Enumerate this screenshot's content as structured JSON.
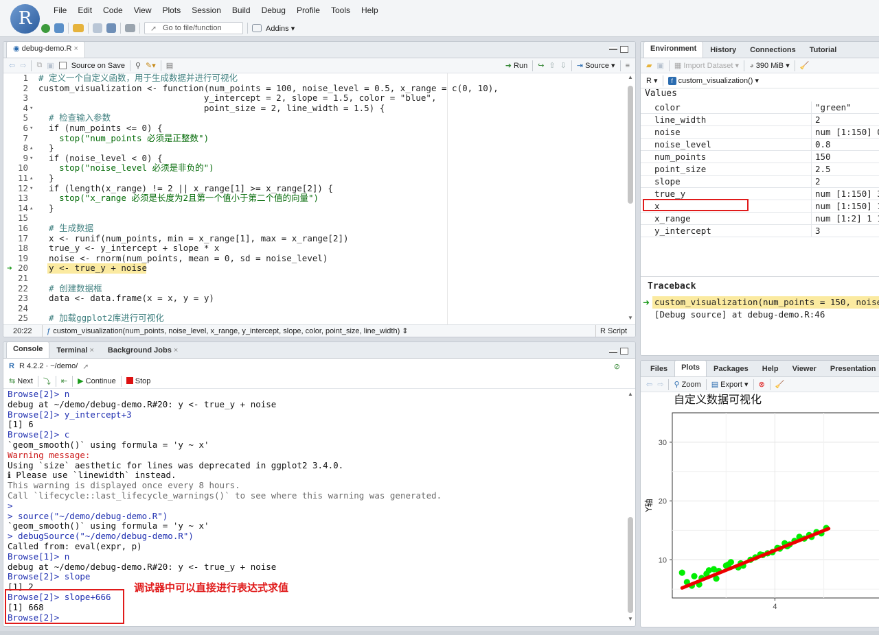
{
  "menubar": {
    "logo": "R",
    "menus": [
      "File",
      "Edit",
      "Code",
      "View",
      "Plots",
      "Session",
      "Build",
      "Debug",
      "Profile",
      "Tools",
      "Help"
    ],
    "goto_placeholder": "Go to file/function",
    "addins": "Addins"
  },
  "editor": {
    "tab_label": "debug-demo.R",
    "source_on_save": "Source on Save",
    "run_label": "Run",
    "source_label": "Source",
    "cursor_pos": "20:22",
    "function_crumb": "custom_visualization(num_points, noise_level, x_range, y_intercept, slope, color, point_size, line_width)",
    "file_type": "R Script",
    "lines": [
      {
        "n": "1",
        "fold": "",
        "text": "# 定义一个自定义函数，用于生成数据并进行可视化",
        "cls": "cm"
      },
      {
        "n": "2",
        "fold": "",
        "text": "custom_visualization <- function(num_points = 100, noise_level = 0.5, x_range = c(0, 10),",
        "cls": "fn"
      },
      {
        "n": "3",
        "fold": "",
        "text": "                                y_intercept = 2, slope = 1.5, color = \"blue\",",
        "cls": "fn"
      },
      {
        "n": "4",
        "fold": "▾",
        "text": "                                point_size = 2, line_width = 1.5) {",
        "cls": "fn"
      },
      {
        "n": "5",
        "fold": "",
        "text": "  # 检查输入参数",
        "cls": "cm"
      },
      {
        "n": "6",
        "fold": "▾",
        "text": "  if (num_points <= 0) {",
        "cls": "fn"
      },
      {
        "n": "7",
        "fold": "",
        "text": "    stop(\"num_points 必须是正整数\")",
        "cls": "str"
      },
      {
        "n": "8",
        "fold": "▴",
        "text": "  }",
        "cls": "fn"
      },
      {
        "n": "9",
        "fold": "▾",
        "text": "  if (noise_level < 0) {",
        "cls": "fn"
      },
      {
        "n": "10",
        "fold": "",
        "text": "    stop(\"noise_level 必须是非负的\")",
        "cls": "str"
      },
      {
        "n": "11",
        "fold": "▴",
        "text": "  }",
        "cls": "fn"
      },
      {
        "n": "12",
        "fold": "▾",
        "text": "  if (length(x_range) != 2 || x_range[1] >= x_range[2]) {",
        "cls": "fn"
      },
      {
        "n": "13",
        "fold": "",
        "text": "    stop(\"x_range 必须是长度为2且第一个值小于第二个值的向量\")",
        "cls": "str"
      },
      {
        "n": "14",
        "fold": "▴",
        "text": "  }",
        "cls": "fn"
      },
      {
        "n": "15",
        "fold": "",
        "text": "",
        "cls": "fn"
      },
      {
        "n": "16",
        "fold": "",
        "text": "  # 生成数据",
        "cls": "cm"
      },
      {
        "n": "17",
        "fold": "",
        "text": "  x <- runif(num_points, min = x_range[1], max = x_range[2])",
        "cls": "fn"
      },
      {
        "n": "18",
        "fold": "",
        "text": "  true_y <- y_intercept + slope * x",
        "cls": "fn"
      },
      {
        "n": "19",
        "fold": "",
        "text": "  noise <- rnorm(num_points, mean = 0, sd = noise_level)",
        "cls": "fn"
      },
      {
        "n": "20",
        "fold": "",
        "text": "  y <- true_y + noise",
        "cls": "fn"
      },
      {
        "n": "21",
        "fold": "",
        "text": "",
        "cls": "fn"
      },
      {
        "n": "22",
        "fold": "",
        "text": "  # 创建数据框",
        "cls": "cm"
      },
      {
        "n": "23",
        "fold": "",
        "text": "  data <- data.frame(x = x, y = y)",
        "cls": "fn"
      },
      {
        "n": "24",
        "fold": "",
        "text": "",
        "cls": "fn"
      },
      {
        "n": "25",
        "fold": "",
        "text": "  # 加载ggplot2库进行可视化",
        "cls": "cm"
      }
    ]
  },
  "console": {
    "tabs": [
      "Console",
      "Terminal",
      "Background Jobs"
    ],
    "path": "R 4.2.2 · ~/demo/",
    "next_label": "Next",
    "continue_label": "Continue",
    "stop_label": "Stop",
    "annotation": "调试器中可以直接进行表达式求值",
    "lines": [
      {
        "text": "Browse[2]> n",
        "cls": "blue"
      },
      {
        "text": "debug at ~/demo/debug-demo.R#20: y <- true_y + noise",
        "cls": "black"
      },
      {
        "text": "Browse[2]> y_intercept+3",
        "cls": "blue"
      },
      {
        "text": "[1] 6",
        "cls": "black"
      },
      {
        "text": "Browse[2]> c",
        "cls": "blue"
      },
      {
        "text": "`geom_smooth()` using formula = 'y ~ x'",
        "cls": "black"
      },
      {
        "text": "Warning message:",
        "cls": "red"
      },
      {
        "text": "Using `size` aesthetic for lines was deprecated in ggplot2 3.4.0.",
        "cls": "black"
      },
      {
        "text": "ℹ Please use `linewidth` instead.",
        "cls": "black"
      },
      {
        "text": "This warning is displayed once every 8 hours.",
        "cls": "grey"
      },
      {
        "text": "Call `lifecycle::last_lifecycle_warnings()` to see where this warning was generated.",
        "cls": "grey"
      },
      {
        "text": ">",
        "cls": "blue"
      },
      {
        "text": "> source(\"~/demo/debug-demo.R\")",
        "cls": "blue"
      },
      {
        "text": "`geom_smooth()` using formula = 'y ~ x'",
        "cls": "black"
      },
      {
        "text": "> debugSource(\"~/demo/debug-demo.R\")",
        "cls": "blue"
      },
      {
        "text": "Called from: eval(expr, p)",
        "cls": "black"
      },
      {
        "text": "Browse[1]> n",
        "cls": "blue"
      },
      {
        "text": "debug at ~/demo/debug-demo.R#20: y <- true_y + noise",
        "cls": "black"
      },
      {
        "text": "Browse[2]> slope",
        "cls": "blue"
      },
      {
        "text": "[1] 2",
        "cls": "black"
      },
      {
        "text": "Browse[2]> slope+666",
        "cls": "blue"
      },
      {
        "text": "[1] 668",
        "cls": "black"
      },
      {
        "text": "Browse[2]>",
        "cls": "blue"
      }
    ]
  },
  "environment": {
    "tabs": [
      "Environment",
      "History",
      "Connections",
      "Tutorial"
    ],
    "import_label": "Import Dataset",
    "memory": "390 MiB",
    "lang": "R",
    "scope": "custom_visualization()",
    "section": "Values",
    "rows": [
      {
        "name": "color",
        "value": "\"green\""
      },
      {
        "name": "line_width",
        "value": "2"
      },
      {
        "name": "noise",
        "value": "num [1:150] 0"
      },
      {
        "name": "noise_level",
        "value": "0.8"
      },
      {
        "name": "num_points",
        "value": "150"
      },
      {
        "name": "point_size",
        "value": "2.5"
      },
      {
        "name": "slope",
        "value": "2"
      },
      {
        "name": "true_y",
        "value": "num [1:150] 3"
      },
      {
        "name": "x",
        "value": "num [1:150] 1"
      },
      {
        "name": "x_range",
        "value": "num [1:2] 1 1"
      },
      {
        "name": "y_intercept",
        "value": "3"
      }
    ],
    "traceback_title": "Traceback",
    "traceback": [
      {
        "text": "custom_visualization(num_points = 150, noise",
        "active": true
      },
      {
        "text": "[Debug source] at debug-demo.R:46",
        "active": false
      }
    ]
  },
  "plots": {
    "tabs": [
      "Files",
      "Plots",
      "Packages",
      "Help",
      "Viewer",
      "Presentation"
    ],
    "zoom_label": "Zoom",
    "export_label": "Export",
    "chart_data": {
      "type": "scatter",
      "title": "自定义数据可视化",
      "ylabel": "Y轴",
      "xlabel": "",
      "x_ticks": [
        "4"
      ],
      "y_ticks": [
        "10",
        "20",
        "30"
      ],
      "xlim": [
        1.9,
        6.2
      ],
      "ylim": [
        3.5,
        35
      ],
      "point_color": "#00ee00",
      "line_color": "#ee0000",
      "points": [
        [
          2.1,
          7.8
        ],
        [
          2.2,
          6.2
        ],
        [
          2.3,
          5.6
        ],
        [
          2.35,
          7.2
        ],
        [
          2.45,
          5.8
        ],
        [
          2.5,
          6.9
        ],
        [
          2.6,
          7.6
        ],
        [
          2.65,
          8.2
        ],
        [
          2.75,
          8.4
        ],
        [
          2.8,
          6.8
        ],
        [
          2.85,
          8.1
        ],
        [
          3.0,
          9.0
        ],
        [
          3.05,
          9.2
        ],
        [
          3.1,
          9.6
        ],
        [
          3.25,
          8.7
        ],
        [
          3.3,
          9.4
        ],
        [
          3.35,
          9.0
        ],
        [
          3.5,
          10.0
        ],
        [
          3.6,
          10.4
        ],
        [
          3.7,
          10.9
        ],
        [
          3.75,
          10.8
        ],
        [
          3.85,
          11.1
        ],
        [
          3.95,
          11.3
        ],
        [
          4.05,
          12.0
        ],
        [
          4.1,
          11.9
        ],
        [
          4.2,
          12.8
        ],
        [
          4.25,
          12.3
        ],
        [
          4.3,
          12.6
        ],
        [
          4.4,
          13.2
        ],
        [
          4.5,
          13.9
        ],
        [
          4.6,
          13.6
        ],
        [
          4.7,
          14.2
        ],
        [
          4.75,
          13.9
        ],
        [
          4.85,
          14.7
        ],
        [
          4.95,
          14.5
        ],
        [
          5.05,
          15.4
        ]
      ],
      "fit_line": [
        [
          2.1,
          5.2
        ],
        [
          5.1,
          15.3
        ]
      ]
    }
  }
}
